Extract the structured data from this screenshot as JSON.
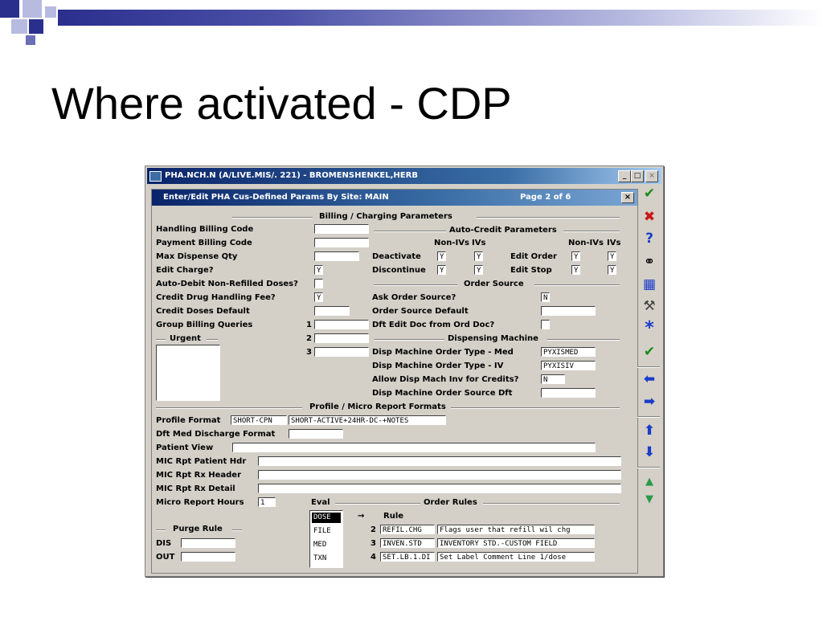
{
  "slide": {
    "title": "Where activated - CDP"
  },
  "window": {
    "title": "PHA.NCH.N (A/LIVE.MIS/. 221) - BROMENSHENKEL,HERB",
    "btn_min": "_",
    "btn_max": "□",
    "btn_close": "×",
    "header": {
      "left": "Enter/Edit PHA Cus-Defined Params By Site: MAIN",
      "page": "Page 2 of 6",
      "close": "×"
    },
    "sections": {
      "billing": "Billing / Charging Parameters",
      "autocredit": "Auto-Credit Parameters",
      "ordersource": "Order Source",
      "dispensing": "Dispensing Machine",
      "profile": "Profile / Micro Report Formats",
      "urgent": "Urgent",
      "purge": "Purge Rule",
      "eval": "Eval",
      "orderrules": "Order Rules"
    },
    "billing": {
      "handling": "Handling Billing Code",
      "payment": "Payment Billing Code",
      "maxdisp": "Max Dispense Qty",
      "editcharge": "Edit Charge?",
      "editcharge_val": "Y",
      "autodebit": "Auto-Debit Non-Refilled Doses?",
      "creditfee": "Credit Drug Handling Fee?",
      "creditfee_val": "Y",
      "creditdoses": "Credit Doses Default",
      "groupbilling": "Group Billing Queries",
      "n1": "1",
      "n2": "2",
      "n3": "3"
    },
    "autocredit": {
      "nonivs1": "Non-IVs",
      "ivs1": "IVs",
      "nonivs2": "Non-IVs",
      "ivs2": "IVs",
      "deactivate": "Deactivate",
      "deact_a": "Y",
      "deact_b": "Y",
      "editorder": "Edit Order",
      "eo_a": "Y",
      "eo_b": "Y",
      "discontinue": "Discontinue",
      "disc_a": "Y",
      "disc_b": "Y",
      "editstop": "Edit Stop",
      "es_a": "Y",
      "es_b": "Y"
    },
    "ordersource": {
      "ask": "Ask Order Source?",
      "ask_val": "N",
      "default": "Order Source Default",
      "dftedit": "Dft Edit Doc from Ord Doc?"
    },
    "dispensing": {
      "med": "Disp Machine Order Type - Med",
      "med_val": "PYXISMED",
      "iv": "Disp Machine Order Type - IV",
      "iv_val": "PYXISIV",
      "allow": "Allow Disp Mach Inv for Credits?",
      "allow_val": "N",
      "srcdft": "Disp Machine Order Source Dft"
    },
    "profile": {
      "format": "Profile Format",
      "format_val1": "SHORT-CPN",
      "format_val2": "SHORT-ACTIVE+24HR-DC-+NOTES",
      "discharge": "Dft Med Discharge Format",
      "patientview": "Patient View",
      "micpatient": "MIC Rpt Patient Hdr",
      "micrx": "MIC Rpt Rx Header",
      "micdetail": "MIC Rpt Rx Detail",
      "microhours": "Micro Report Hours",
      "microhours_val": "1"
    },
    "purge": {
      "dis": "DIS",
      "out": "OUT"
    },
    "eval": {
      "items": [
        "DOSE",
        "FILE",
        "MED",
        "TXN"
      ],
      "arrow": "→"
    },
    "orderrules": {
      "rule_header": "Rule",
      "rows": [
        {
          "num": "2",
          "rule": "REFIL.CHG",
          "desc": "Flags user that refill wil chg"
        },
        {
          "num": "3",
          "rule": "INVEN.STD",
          "desc": "INVENTORY STD.-CUSTOM FIELD"
        },
        {
          "num": "4",
          "rule": "SET.LB.1.DI",
          "desc": "Set Label Comment Line 1/dose"
        }
      ]
    }
  },
  "toolbar": {
    "check": "✔",
    "cancel": "✖",
    "help": "?",
    "find": "⚭",
    "tableedit": "▦",
    "tools": "⚒",
    "asterisk": "*",
    "checkall": "✔",
    "left": "⬅",
    "right": "➡",
    "up": "⬆",
    "down": "⬇",
    "pageup": "▲",
    "pagedown": "▼",
    "colors": {
      "green": "#1a8a1a",
      "red": "#c81818",
      "blue": "#1a3cc8"
    }
  }
}
